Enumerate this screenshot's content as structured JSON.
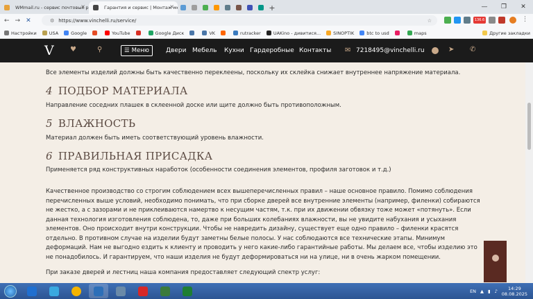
{
  "browser": {
    "tabs": [
      {
        "title": "WMmail.ru - сервис почтовых ра",
        "color": "#e7a23b"
      },
      {
        "title": "Гарантия и сервис | Монтаж меж",
        "color": "#444444"
      }
    ],
    "url": "https://www.vinchelli.ru/service/",
    "bookmarks": [
      {
        "label": "Настройки",
        "color": "#777777"
      },
      {
        "label": "USA",
        "color": "#b9a050"
      },
      {
        "label": "Google",
        "color": "#4285f4"
      },
      {
        "label": "",
        "color": "#e44d26"
      },
      {
        "label": "YouTube",
        "color": "#ff0000"
      },
      {
        "label": "",
        "color": "#d93025"
      },
      {
        "label": "Google Диск",
        "color": "#1fa463"
      },
      {
        "label": "",
        "color": "#4a76a8"
      },
      {
        "label": "VK",
        "color": "#4a76a8"
      },
      {
        "label": "",
        "color": "#ff6600"
      },
      {
        "label": "rutracker",
        "color": "#3b7bbf"
      },
      {
        "label": "UAKino - дивитися...",
        "color": "#222222"
      },
      {
        "label": "SINOPTIK",
        "color": "#f9a825"
      },
      {
        "label": "btc to usd",
        "color": "#4285f4"
      },
      {
        "label": "",
        "color": "#e91e63"
      },
      {
        "label": "maps",
        "color": "#34a853"
      }
    ],
    "other_bookmarks": "Другие закладки",
    "ext_badge": "136.6"
  },
  "site": {
    "logo": "V",
    "menu_label": "Меню",
    "nav": [
      "Двери",
      "Мебель",
      "Кухни",
      "Гардеробные",
      "Контакты"
    ],
    "email": "7218495@vinchelli.ru"
  },
  "article": {
    "p_top": "Все элементы изделий должны быть качественно переклеены, поскольку их склейка снижает внутреннее напряжение материала.",
    "s4": {
      "num": "4",
      "title": "ПОДБОР МАТЕРИАЛА",
      "text": "Направление соседних плашек в склеенной доске или щите должно быть противоположным."
    },
    "s5": {
      "num": "5",
      "title": "ВЛАЖНОСТЬ",
      "text": "Материал должен быть иметь соответствующий уровень влажности."
    },
    "s6": {
      "num": "6",
      "title": "ПРАВИЛЬНАЯ ПРИСАДКА",
      "text": "Применяется ряд конструктивных наработок (особенности соединения элементов, профиля заготовок и т.д.)"
    },
    "long": "Качественное производство со строгим соблюдением всех вышеперечисленных правил – наше основное правило. Помимо соблюдения перечисленных выше условий, необходимо понимать, что при сборке дверей все внутренние элементы (например, филенки) собираются не жестко, а с зазорами и не приклеиваются намертво к несущим частям, т.к. при их движении обвязку тоже может «потянуть». Если данная технология изготовления соблюдена, то, даже при больших колебаниях влажности, вы не увидите набухания и усыхания элементов. Оно происходит внутри конструкции. Чтобы не навредить дизайну, существует еще одно правило – филенки красятся отдельно. В противном случае на изделии будут заметны белые полосы. У нас соблюдаются все технические этапы. Минимум деформаций. Нам не выгодно ездить к клиенту и проводить у него какие-либо гарантийные работы. Мы делаем все, чтобы изделию это не понадобилось. И гарантируем, что наши изделия не будут деформироваться ни на улице, ни в очень жарком помещении.",
    "last": "При заказе дверей и лестниц наша компания предоставляет следующий спектр услуг:"
  },
  "taskbar": {
    "lang": "EN",
    "time": "14:29",
    "date": "08.08.2025",
    "apps": [
      "#1f6fd0",
      "#3aa9e0",
      "#f4b400",
      "#2d6fb8",
      "#6a8aa8",
      "#d62828",
      "#3b7a3b",
      "#1e7e34"
    ]
  }
}
